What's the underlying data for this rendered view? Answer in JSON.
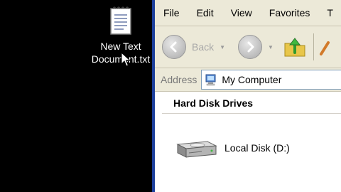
{
  "desktop": {
    "icon_label_line1": "New Text",
    "icon_label_line2": "Document.txt"
  },
  "window": {
    "menu": [
      "File",
      "Edit",
      "View",
      "Favorites",
      "T"
    ],
    "toolbar": {
      "back_label": "Back"
    },
    "address": {
      "label": "Address",
      "value": "My Computer"
    },
    "content": {
      "group_header": "Hard Disk Drives",
      "drives": [
        {
          "label": "Local Disk (D:)"
        }
      ]
    }
  },
  "colors": {
    "window_chrome": "#ece9d8",
    "window_border": "#1c3f9c",
    "desktop_background": "#000000"
  }
}
